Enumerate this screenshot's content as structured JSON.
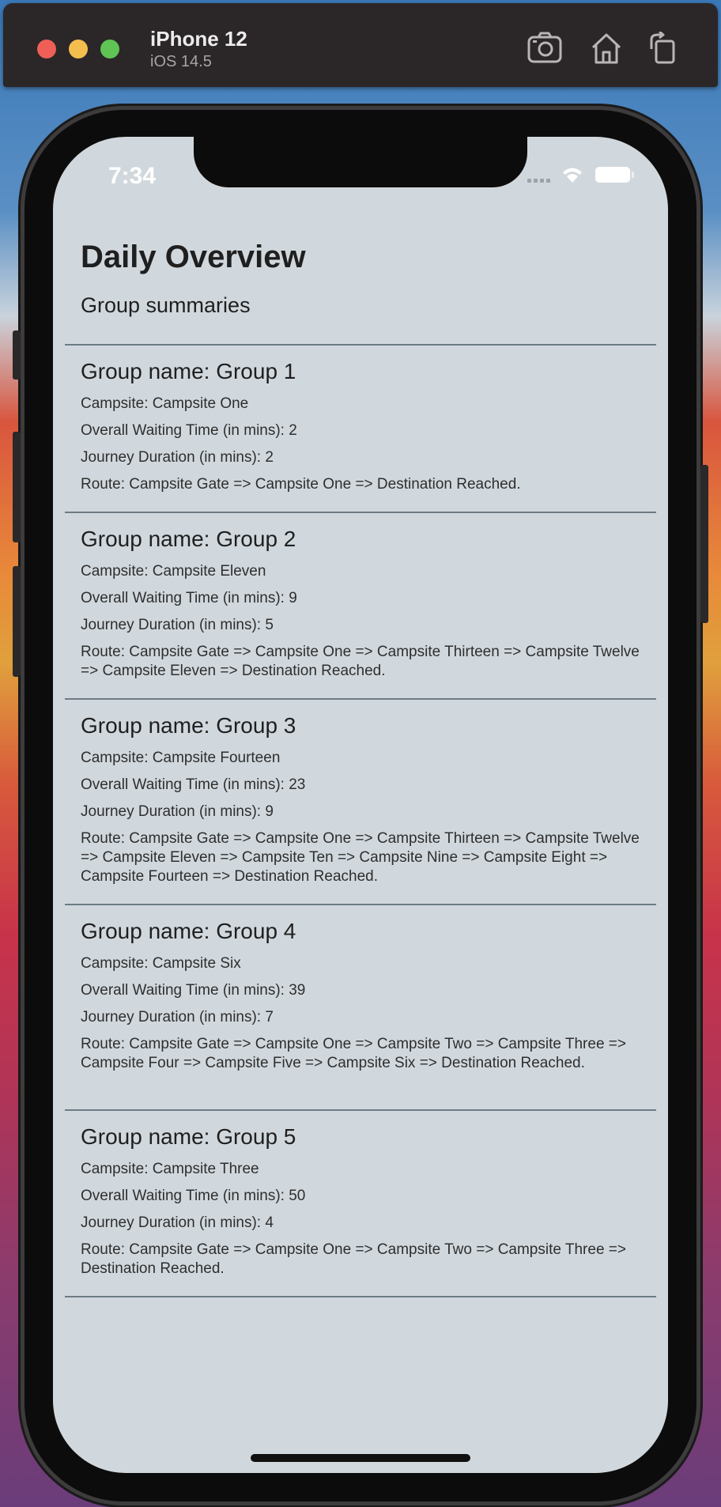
{
  "simulator": {
    "device": "iPhone 12",
    "os": "iOS 14.5",
    "icons": [
      "screenshot-icon",
      "home-icon",
      "rotate-icon"
    ]
  },
  "status": {
    "time": "7:34"
  },
  "page": {
    "title": "Daily Overview",
    "subtitle": "Group summaries"
  },
  "groups": [
    {
      "name": "Group name: Group 1",
      "campsite": "Campsite: Campsite One",
      "waiting": "Overall Waiting Time (in mins): 2",
      "duration": "Journey Duration (in mins): 2",
      "route": "Route: Campsite Gate => Campsite One =>  Destination Reached."
    },
    {
      "name": "Group name: Group 2",
      "campsite": "Campsite: Campsite Eleven",
      "waiting": "Overall Waiting Time (in mins): 9",
      "duration": "Journey Duration (in mins): 5",
      "route": "Route: Campsite Gate => Campsite One => Campsite Thirteen => Campsite Twelve => Campsite Eleven =>  Destination Reached."
    },
    {
      "name": "Group name: Group 3",
      "campsite": "Campsite: Campsite Fourteen",
      "waiting": "Overall Waiting Time (in mins): 23",
      "duration": "Journey Duration (in mins): 9",
      "route": "Route: Campsite Gate => Campsite One => Campsite Thirteen => Campsite Twelve => Campsite Eleven => Campsite Ten => Campsite Nine => Campsite Eight => Campsite Fourteen =>  Destination Reached."
    },
    {
      "name": "Group name: Group 4",
      "campsite": "Campsite: Campsite Six",
      "waiting": "Overall Waiting Time (in mins): 39",
      "duration": "Journey Duration (in mins): 7",
      "route": "Route: Campsite Gate => Campsite One => Campsite Two => Campsite Three => Campsite Four => Campsite Five => Campsite Six =>  Destination Reached."
    },
    {
      "name": "Group name: Group 5",
      "campsite": "Campsite: Campsite Three",
      "waiting": "Overall Waiting Time (in mins): 50",
      "duration": "Journey Duration (in mins): 4",
      "route": "Route: Campsite Gate => Campsite One => Campsite Two => Campsite Three =>  Destination Reached."
    }
  ]
}
